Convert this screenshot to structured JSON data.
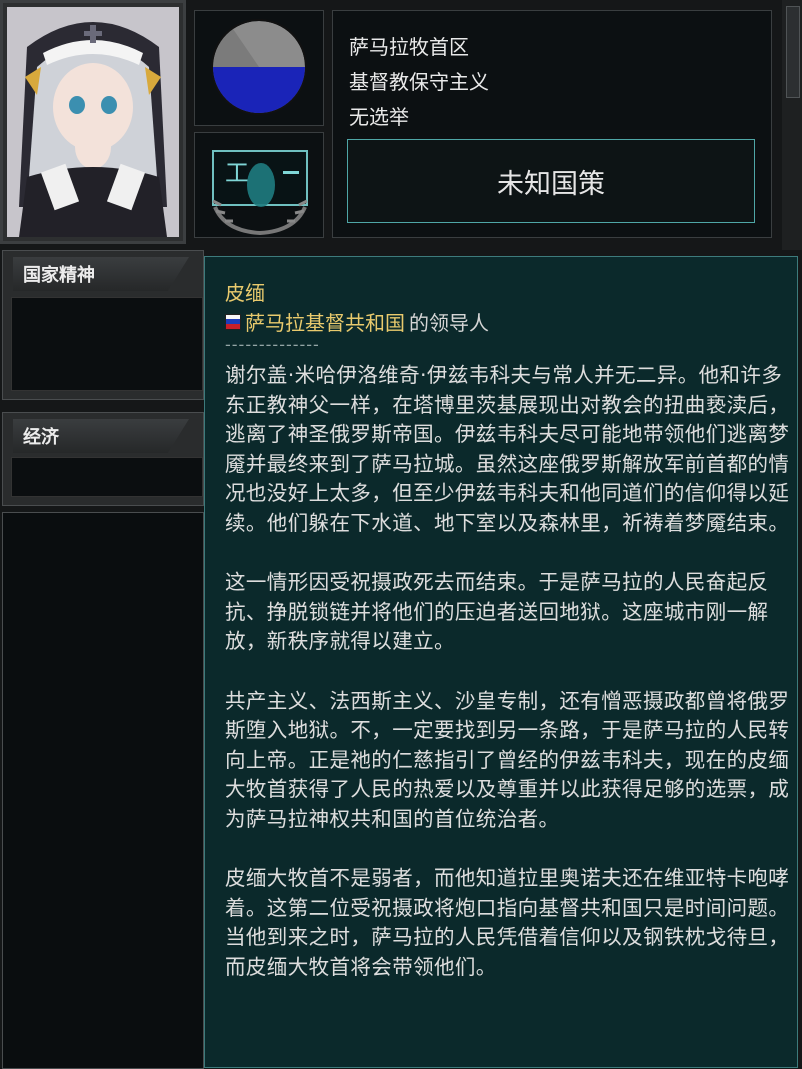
{
  "leader": {
    "portrait_label": "leader-portrait"
  },
  "info": {
    "state_name": "萨马拉牧首区",
    "ideology": "基督教保守主义",
    "elections": "无选举",
    "policy_button": "未知国策"
  },
  "popularity": {
    "blue_fraction": 0.5,
    "colors": {
      "blue": "#1a24b8",
      "gray": "#8c8c8c"
    }
  },
  "panels": {
    "national_spirit": "国家精神",
    "economy": "经济"
  },
  "tooltip": {
    "title": "皮缅",
    "country": "萨马拉基督共和国",
    "role_suffix": "的领导人",
    "separator": "--------------",
    "paragraphs": [
      "谢尔盖·米哈伊洛维奇·伊兹韦科夫与常人并无二异。他和许多东正教神父一样，在塔博里茨基展现出对教会的扭曲亵渎后，逃离了神圣俄罗斯帝国。伊兹韦科夫尽可能地带领他们逃离梦魇并最终来到了萨马拉城。虽然这座俄罗斯解放军前首都的情况也没好上太多，但至少伊兹韦科夫和他同道们的信仰得以延续。他们躲在下水道、地下室以及森林里，祈祷着梦魇结束。",
      "这一情形因受祝摄政死去而结束。于是萨马拉的人民奋起反抗、挣脱锁链并将他们的压迫者送回地狱。这座城市刚一解放，新秩序就得以建立。",
      "共产主义、法西斯主义、沙皇专制，还有憎恶摄政都曾将俄罗斯堕入地狱。不，一定要找到另一条路，于是萨马拉的人民转向上帝。正是祂的仁慈指引了曾经的伊兹韦科夫，现在的皮缅大牧首获得了人民的热爱以及尊重并以此获得足够的选票，成为萨马拉神权共和国的首位统治者。",
      "皮缅大牧首不是弱者，而他知道拉里奥诺夫还在维亚特卡咆哮着。这第二位受祝摄政将炮口指向基督共和国只是时间问题。当他到来之时，萨马拉的人民凭借着信仰以及钢铁枕戈待旦，而皮缅大牧首将会带领他们。"
    ],
    "flag_colors": [
      "#ffffff",
      "#1f3fbf",
      "#d0202a"
    ]
  }
}
